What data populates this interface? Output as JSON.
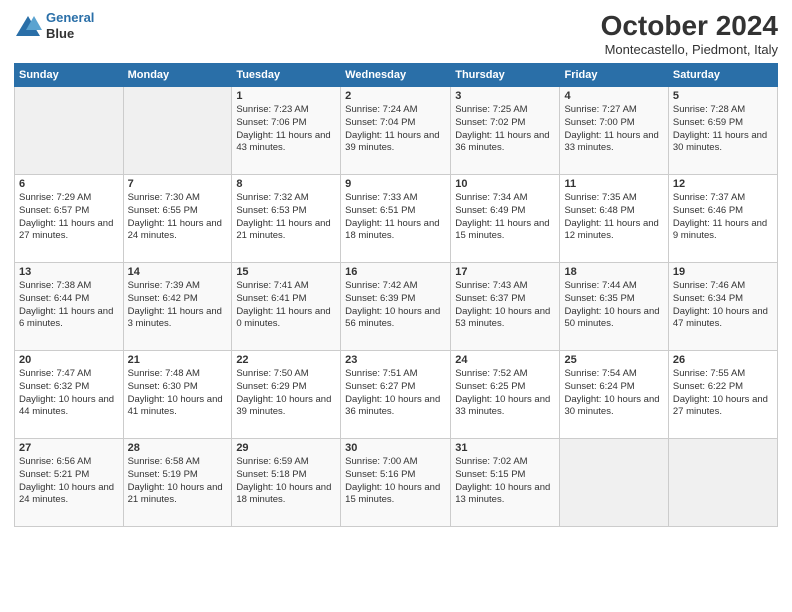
{
  "header": {
    "logo_line1": "General",
    "logo_line2": "Blue",
    "month": "October 2024",
    "location": "Montecastello, Piedmont, Italy"
  },
  "weekdays": [
    "Sunday",
    "Monday",
    "Tuesday",
    "Wednesday",
    "Thursday",
    "Friday",
    "Saturday"
  ],
  "weeks": [
    [
      {
        "day": "",
        "info": ""
      },
      {
        "day": "",
        "info": ""
      },
      {
        "day": "1",
        "info": "Sunrise: 7:23 AM\nSunset: 7:06 PM\nDaylight: 11 hours and 43 minutes."
      },
      {
        "day": "2",
        "info": "Sunrise: 7:24 AM\nSunset: 7:04 PM\nDaylight: 11 hours and 39 minutes."
      },
      {
        "day": "3",
        "info": "Sunrise: 7:25 AM\nSunset: 7:02 PM\nDaylight: 11 hours and 36 minutes."
      },
      {
        "day": "4",
        "info": "Sunrise: 7:27 AM\nSunset: 7:00 PM\nDaylight: 11 hours and 33 minutes."
      },
      {
        "day": "5",
        "info": "Sunrise: 7:28 AM\nSunset: 6:59 PM\nDaylight: 11 hours and 30 minutes."
      }
    ],
    [
      {
        "day": "6",
        "info": "Sunrise: 7:29 AM\nSunset: 6:57 PM\nDaylight: 11 hours and 27 minutes."
      },
      {
        "day": "7",
        "info": "Sunrise: 7:30 AM\nSunset: 6:55 PM\nDaylight: 11 hours and 24 minutes."
      },
      {
        "day": "8",
        "info": "Sunrise: 7:32 AM\nSunset: 6:53 PM\nDaylight: 11 hours and 21 minutes."
      },
      {
        "day": "9",
        "info": "Sunrise: 7:33 AM\nSunset: 6:51 PM\nDaylight: 11 hours and 18 minutes."
      },
      {
        "day": "10",
        "info": "Sunrise: 7:34 AM\nSunset: 6:49 PM\nDaylight: 11 hours and 15 minutes."
      },
      {
        "day": "11",
        "info": "Sunrise: 7:35 AM\nSunset: 6:48 PM\nDaylight: 11 hours and 12 minutes."
      },
      {
        "day": "12",
        "info": "Sunrise: 7:37 AM\nSunset: 6:46 PM\nDaylight: 11 hours and 9 minutes."
      }
    ],
    [
      {
        "day": "13",
        "info": "Sunrise: 7:38 AM\nSunset: 6:44 PM\nDaylight: 11 hours and 6 minutes."
      },
      {
        "day": "14",
        "info": "Sunrise: 7:39 AM\nSunset: 6:42 PM\nDaylight: 11 hours and 3 minutes."
      },
      {
        "day": "15",
        "info": "Sunrise: 7:41 AM\nSunset: 6:41 PM\nDaylight: 11 hours and 0 minutes."
      },
      {
        "day": "16",
        "info": "Sunrise: 7:42 AM\nSunset: 6:39 PM\nDaylight: 10 hours and 56 minutes."
      },
      {
        "day": "17",
        "info": "Sunrise: 7:43 AM\nSunset: 6:37 PM\nDaylight: 10 hours and 53 minutes."
      },
      {
        "day": "18",
        "info": "Sunrise: 7:44 AM\nSunset: 6:35 PM\nDaylight: 10 hours and 50 minutes."
      },
      {
        "day": "19",
        "info": "Sunrise: 7:46 AM\nSunset: 6:34 PM\nDaylight: 10 hours and 47 minutes."
      }
    ],
    [
      {
        "day": "20",
        "info": "Sunrise: 7:47 AM\nSunset: 6:32 PM\nDaylight: 10 hours and 44 minutes."
      },
      {
        "day": "21",
        "info": "Sunrise: 7:48 AM\nSunset: 6:30 PM\nDaylight: 10 hours and 41 minutes."
      },
      {
        "day": "22",
        "info": "Sunrise: 7:50 AM\nSunset: 6:29 PM\nDaylight: 10 hours and 39 minutes."
      },
      {
        "day": "23",
        "info": "Sunrise: 7:51 AM\nSunset: 6:27 PM\nDaylight: 10 hours and 36 minutes."
      },
      {
        "day": "24",
        "info": "Sunrise: 7:52 AM\nSunset: 6:25 PM\nDaylight: 10 hours and 33 minutes."
      },
      {
        "day": "25",
        "info": "Sunrise: 7:54 AM\nSunset: 6:24 PM\nDaylight: 10 hours and 30 minutes."
      },
      {
        "day": "26",
        "info": "Sunrise: 7:55 AM\nSunset: 6:22 PM\nDaylight: 10 hours and 27 minutes."
      }
    ],
    [
      {
        "day": "27",
        "info": "Sunrise: 6:56 AM\nSunset: 5:21 PM\nDaylight: 10 hours and 24 minutes."
      },
      {
        "day": "28",
        "info": "Sunrise: 6:58 AM\nSunset: 5:19 PM\nDaylight: 10 hours and 21 minutes."
      },
      {
        "day": "29",
        "info": "Sunrise: 6:59 AM\nSunset: 5:18 PM\nDaylight: 10 hours and 18 minutes."
      },
      {
        "day": "30",
        "info": "Sunrise: 7:00 AM\nSunset: 5:16 PM\nDaylight: 10 hours and 15 minutes."
      },
      {
        "day": "31",
        "info": "Sunrise: 7:02 AM\nSunset: 5:15 PM\nDaylight: 10 hours and 13 minutes."
      },
      {
        "day": "",
        "info": ""
      },
      {
        "day": "",
        "info": ""
      }
    ]
  ]
}
